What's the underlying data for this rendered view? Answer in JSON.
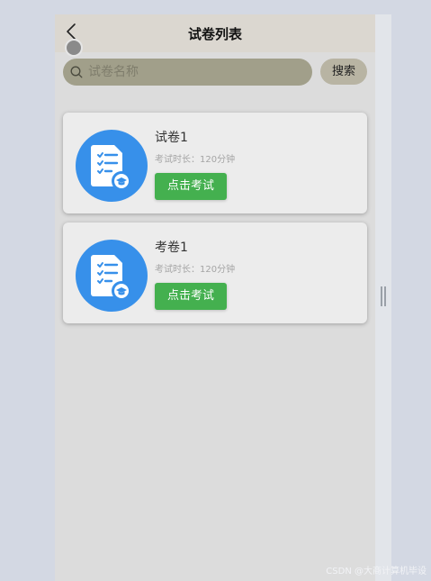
{
  "header": {
    "title": "试卷列表",
    "back_icon": "chevron-left-icon"
  },
  "search": {
    "placeholder": "试卷名称",
    "value": "",
    "button_label": "搜索",
    "icon": "search-icon"
  },
  "papers": [
    {
      "name": "试卷1",
      "meta": "考试时长：120分钟",
      "action_label": "点击考试",
      "icon": "exam-sheet-icon"
    },
    {
      "name": "考卷1",
      "meta": "考试时长：120分钟",
      "action_label": "点击考试",
      "icon": "exam-sheet-icon"
    }
  ],
  "watermark": "CSDN @大商计算机毕设",
  "colors": {
    "accent_blue": "#3790ea",
    "action_green": "#44b04f",
    "search_bg": "#a19f8a",
    "nav_bg": "#dbd7d0"
  }
}
